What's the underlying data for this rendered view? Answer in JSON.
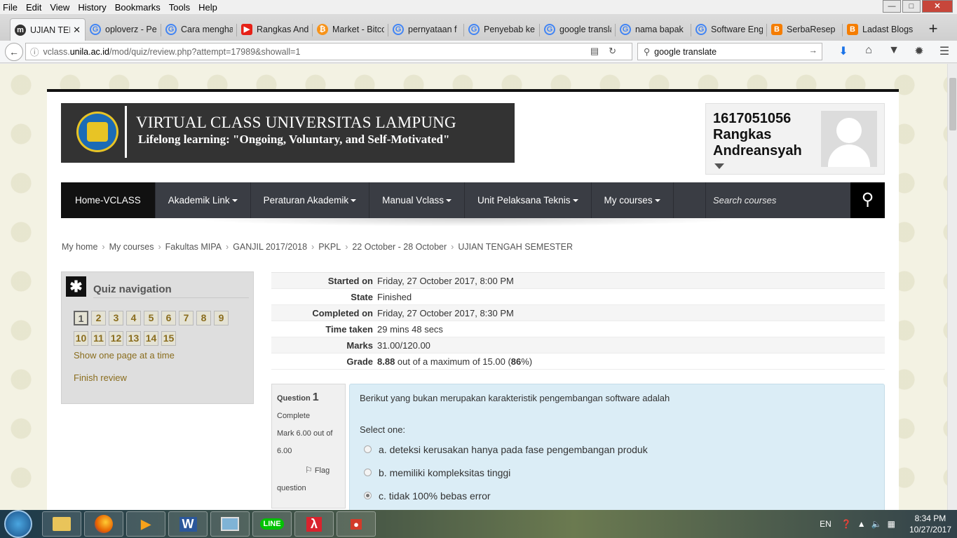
{
  "menubar": {
    "items": [
      "File",
      "Edit",
      "View",
      "History",
      "Bookmarks",
      "Tools",
      "Help"
    ]
  },
  "tabs": [
    {
      "label": "UJIAN TENGAH SEMESTER",
      "icon": "moodle-icon",
      "active": true
    },
    {
      "label": "oploverz - Per",
      "icon": "google-icon"
    },
    {
      "label": "Cara menghapus",
      "icon": "google-icon"
    },
    {
      "label": "Rangkas Andre",
      "icon": "youtube-icon"
    },
    {
      "label": "Market - Bitcoin",
      "icon": "bitcoin-icon"
    },
    {
      "label": "pernyataan f",
      "icon": "google-icon"
    },
    {
      "label": "Penyebab ke",
      "icon": "google-icon"
    },
    {
      "label": "google transla",
      "icon": "google-icon"
    },
    {
      "label": "nama bapak",
      "icon": "google-icon"
    },
    {
      "label": "Software Eng",
      "icon": "google-icon"
    },
    {
      "label": "SerbaResep",
      "icon": "blogger-icon"
    },
    {
      "label": "Ladast Blogs",
      "icon": "blogger-icon"
    }
  ],
  "address": {
    "domain_prefix": "vclass.",
    "domain": "unila.ac.id",
    "path": "/mod/quiz/review.php?attempt=17989&showall=1"
  },
  "search": {
    "value": "google translate"
  },
  "banner": {
    "title": "VIRTUAL CLASS UNIVERSITAS LAMPUNG",
    "subtitle": "Lifelong learning: \"Ongoing, Voluntary, and Self-Motivated\""
  },
  "user": {
    "id": "1617051056",
    "name1": "Rangkas",
    "name2": "Andreansyah"
  },
  "nav": {
    "home": "Home-VCLASS",
    "items": [
      "Akademik Link",
      "Peraturan Akademik",
      "Manual Vclass",
      "Unit Pelaksana Teknis",
      "My courses"
    ],
    "search_placeholder": "Search courses"
  },
  "breadcrumb": [
    "My home",
    "My courses",
    "Fakultas MIPA",
    "GANJIL 2017/2018",
    "PKPL",
    "22 October - 28 October",
    "UJIAN TENGAH SEMESTER"
  ],
  "quiz_nav": {
    "title": "Quiz navigation",
    "buttons": [
      "1",
      "2",
      "3",
      "4",
      "5",
      "6",
      "7",
      "8",
      "9",
      "10",
      "11",
      "12",
      "13",
      "14",
      "15"
    ],
    "show_one_page": "Show one page at a time",
    "finish_review": "Finish review"
  },
  "summary": [
    {
      "label": "Started on",
      "value": "Friday, 27 October 2017, 8:00 PM"
    },
    {
      "label": "State",
      "value": "Finished"
    },
    {
      "label": "Completed on",
      "value": "Friday, 27 October 2017, 8:30 PM"
    },
    {
      "label": "Time taken",
      "value": "29 mins 48 secs"
    },
    {
      "label": "Marks",
      "value": "31.00/120.00"
    },
    {
      "label": "Grade",
      "value_bold": "8.88",
      "value_mid": " out of a maximum of 15.00 (",
      "value_pct": "86",
      "value_end": "%)"
    }
  ],
  "question": {
    "label": "Question",
    "number": "1",
    "state": "Complete",
    "mark": "Mark 6.00 out of 6.00",
    "flag": "Flag",
    "flag2": "question",
    "text": "Berikut yang bukan merupakan karakteristik pengembangan software adalah",
    "select": "Select one:",
    "options": [
      {
        "text": "a. deteksi kerusakan hanya pada fase pengembangan produk",
        "selected": false
      },
      {
        "text": "b. memiliki kompleksitas tinggi",
        "selected": false
      },
      {
        "text": "c. tidak 100% bebas error",
        "selected": true
      }
    ]
  },
  "taskbar": {
    "lang": "EN",
    "time": "8:34 PM",
    "date": "10/27/2017"
  }
}
